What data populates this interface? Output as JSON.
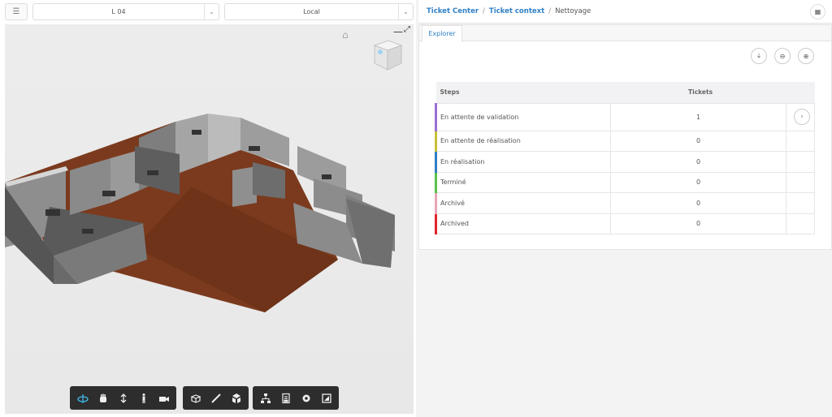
{
  "viewer": {
    "level_select": "L 04",
    "mode_select": "Local",
    "toolbar": {
      "navigation": [
        "orbit-icon",
        "pan-icon",
        "dolly-icon",
        "walk-icon",
        "camera-icon"
      ],
      "modeling": [
        "section-icon",
        "measure-icon",
        "explode-icon"
      ],
      "settings": [
        "model-browser-icon",
        "properties-icon",
        "settings-icon",
        "fullscreen-icon"
      ]
    }
  },
  "breadcrumb": {
    "items": [
      "Ticket Center",
      "Ticket context"
    ],
    "current": "Nettoyage"
  },
  "panel": {
    "tab": "Explorer",
    "actions": [
      "download-icon",
      "minus-circle-icon",
      "target-icon"
    ],
    "table": {
      "headers": [
        "Steps",
        "Tickets"
      ],
      "rows": [
        {
          "label": "En attente de validation",
          "count": "1",
          "color": "#9b6fd6",
          "action": "chevron-right-icon"
        },
        {
          "label": "En attente de réalisation",
          "count": "0",
          "color": "#c7c03a"
        },
        {
          "label": "En réalisation",
          "count": "0",
          "color": "#2f7fc7"
        },
        {
          "label": "Terminé",
          "count": "0",
          "color": "#59c24a"
        },
        {
          "label": "Archivé",
          "count": "0",
          "color": "#e8a6b6"
        },
        {
          "label": "Archived",
          "count": "0",
          "color": "#e2262b"
        }
      ]
    }
  },
  "colors": {
    "accent": "#2f80c7",
    "floor": "#7b3a1e",
    "toolbar": "#2d2d2d"
  }
}
